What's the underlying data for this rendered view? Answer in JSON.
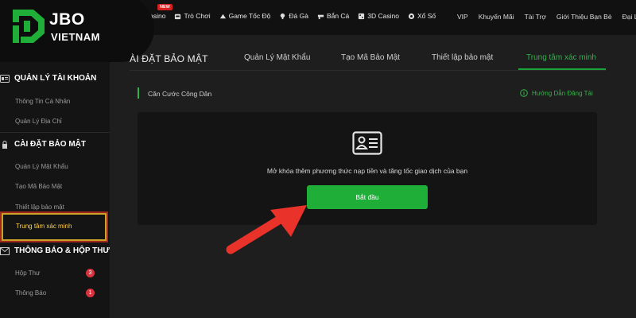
{
  "brand": {
    "line1": "JBO",
    "line2": "VIETNAM"
  },
  "topnav": {
    "items": [
      {
        "label": "Casino",
        "icon": "casino-icon"
      },
      {
        "label": "Trò Chơi",
        "icon": "slot-machine-icon"
      },
      {
        "label": "Game Tốc Độ",
        "icon": "speed-game-icon"
      },
      {
        "label": "Đá Gà",
        "icon": "rooster-icon"
      },
      {
        "label": "Bắn Cá",
        "icon": "gun-icon"
      },
      {
        "label": "3D Casino",
        "icon": "3d-casino-icon"
      },
      {
        "label": "Xổ Số",
        "icon": "lottery-ball-icon"
      }
    ],
    "new_badge": "NEW",
    "right_links": [
      "VIP",
      "Khuyến Mãi",
      "Tài Trợ",
      "Giới Thiệu Bạn Bè",
      "Đại Lý"
    ]
  },
  "sidebar": {
    "account_header": "QUẢN LÝ TÀI KHOẢN",
    "account_items": [
      "Thông Tin Cá Nhân",
      "Quản Lý Địa Chỉ"
    ],
    "security_header": "CÀI ĐẶT BẢO MẬT",
    "security_items": [
      "Quản Lý Mật Khẩu",
      "Tạo Mã Bảo Mật",
      "Thiết lập bảo mật"
    ],
    "active_item": "Trung tâm xác minh",
    "inbox_header": "THÔNG BÁO & HỘP THƯ",
    "inbox_items": [
      {
        "label": "Hộp Thư",
        "count": "3"
      },
      {
        "label": "Thông Báo",
        "count": "1"
      }
    ]
  },
  "main": {
    "title": "ÀI ĐẶT BẢO MẬT",
    "tabs": [
      "Quản Lý Mật Khẩu",
      "Tạo Mã Bảo Mật",
      "Thiết lập bảo mật",
      "Trung tâm xác minh"
    ],
    "active_tab": "Trung tâm xác minh",
    "section_title": "Căn Cước Công Dân",
    "guide_link": "Hướng Dẫn Đăng Tải",
    "card_text": "Mở khóa thêm phương thức nạp tiền và tăng tốc giao dịch của bạn",
    "start_button": "Bắt đầu"
  },
  "colors": {
    "accent_green": "#1fae37",
    "highlight_gold": "#c9a227",
    "badge_red": "#d9333f",
    "arrow_red": "#e8322a"
  }
}
